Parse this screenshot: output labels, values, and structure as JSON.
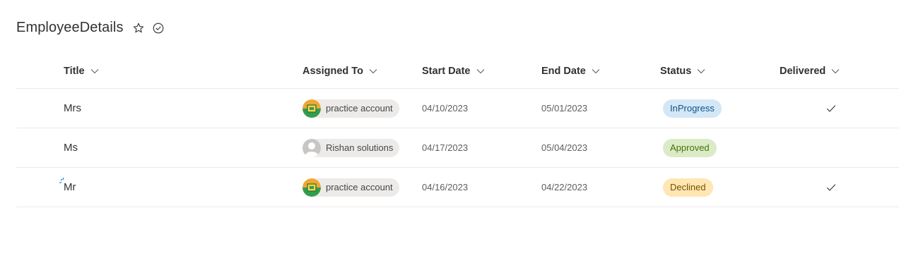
{
  "list": {
    "title": "EmployeeDetails",
    "favorite_icon": "star-icon",
    "status_icon": "check-circle-icon"
  },
  "columns": [
    {
      "label": "Title"
    },
    {
      "label": "Assigned To"
    },
    {
      "label": "Start Date"
    },
    {
      "label": "End Date"
    },
    {
      "label": "Status"
    },
    {
      "label": "Delivered"
    }
  ],
  "rows": [
    {
      "title": "Mrs",
      "assigned_to": "practice account",
      "avatar": "practice-avatar",
      "start_date": "04/10/2023",
      "end_date": "05/01/2023",
      "status": "InProgress",
      "delivered": true
    },
    {
      "title": "Ms",
      "assigned_to": "Rishan solutions",
      "avatar": "default-person-avatar",
      "start_date": "04/17/2023",
      "end_date": "05/04/2023",
      "status": "Approved",
      "delivered": false
    },
    {
      "title": "Mr",
      "assigned_to": "practice account",
      "avatar": "practice-avatar",
      "start_date": "04/16/2023",
      "end_date": "04/22/2023",
      "status": "Declined",
      "delivered": true
    }
  ],
  "status_colors": {
    "InProgress": {
      "bg": "#d4e7f6",
      "fg": "#0f548c"
    },
    "Approved": {
      "bg": "#dbebc7",
      "fg": "#437406"
    },
    "Declined": {
      "bg": "#fee7b2",
      "fg": "#7a4f01"
    }
  }
}
